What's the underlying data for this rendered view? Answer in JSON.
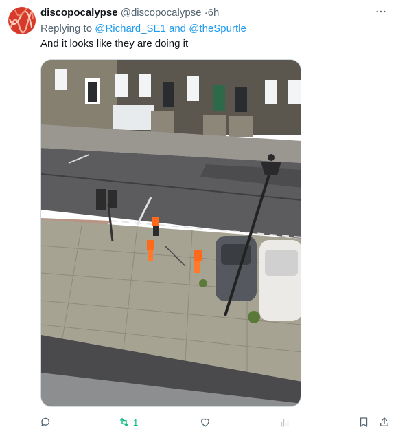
{
  "tweet": {
    "display_name": "discopocalypse",
    "handle": "@discopocalypse",
    "separator": "·",
    "time": "6h",
    "replying_prefix": "Replying to",
    "mention_1": "@Richard_SE1",
    "mention_joiner": "and",
    "mention_2": "@theSpurtle",
    "text": "And it looks like they are doing it",
    "media_icon": "photo",
    "more_icon": "more-horizontal-icon"
  },
  "actions": {
    "reply": {
      "icon": "reply-icon",
      "count": ""
    },
    "retweet": {
      "icon": "retweet-icon",
      "count": "1",
      "color": "#00ba7c"
    },
    "like": {
      "icon": "heart-icon",
      "count": ""
    },
    "views": {
      "icon": "views-icon",
      "count": ""
    },
    "bookmark": {
      "icon": "bookmark-icon"
    },
    "share": {
      "icon": "share-icon"
    }
  },
  "colors": {
    "text_primary": "#0f1419",
    "text_secondary": "#536471",
    "link": "#1d9bf0",
    "retweet_active": "#00ba7c"
  }
}
